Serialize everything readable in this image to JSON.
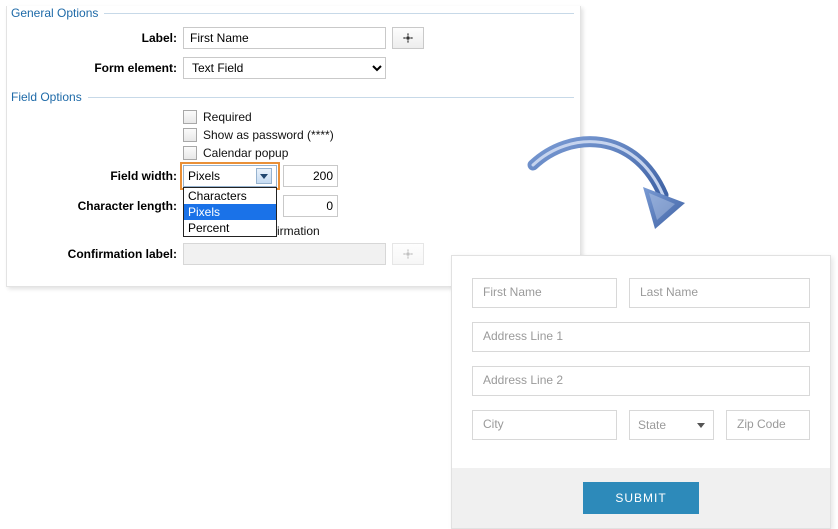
{
  "config": {
    "general_legend": "General Options",
    "field_legend": "Field Options",
    "label_label": "Label:",
    "label_value": "First Name",
    "form_element_label": "Form element:",
    "form_element_value": "Text Field",
    "required_label": "Required",
    "show_password_label": "Show as password (****)",
    "calendar_label": "Calendar popup",
    "field_width_label": "Field width:",
    "field_width_selected": "Pixels",
    "field_width_options": [
      "Characters",
      "Pixels",
      "Percent"
    ],
    "field_width_value": "200",
    "char_length_label": "Character length:",
    "char_length_value": "0",
    "confirmation_checkbox_suffix": "irmation",
    "confirmation_label": "Confirmation label:"
  },
  "preview": {
    "first_name": "First Name",
    "last_name": "Last Name",
    "addr1": "Address Line 1",
    "addr2": "Address Line 2",
    "city": "City",
    "state": "State",
    "zip": "Zip Code",
    "submit": "SUBMIT"
  }
}
